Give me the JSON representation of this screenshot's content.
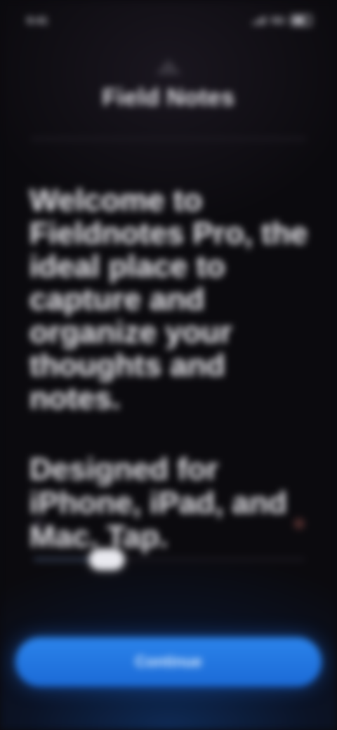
{
  "status_bar": {
    "time": "9:41",
    "network": "5G"
  },
  "header": {
    "logo_icon": "triangle-logo-icon",
    "app_title": "Field Notes"
  },
  "main": {
    "headline": "Welcome to Fieldnotes Pro, the ideal place to capture and organize your thoughts and notes.",
    "subhead": "Designed for iPhone, iPad, and Mac. Tap."
  },
  "onboarding": {
    "slider_progress": 0.27
  },
  "cta": {
    "label": "Continue"
  },
  "colors": {
    "accent": "#1f74e0",
    "background": "#0b0a0e",
    "thumb": "#e9e9ef"
  }
}
